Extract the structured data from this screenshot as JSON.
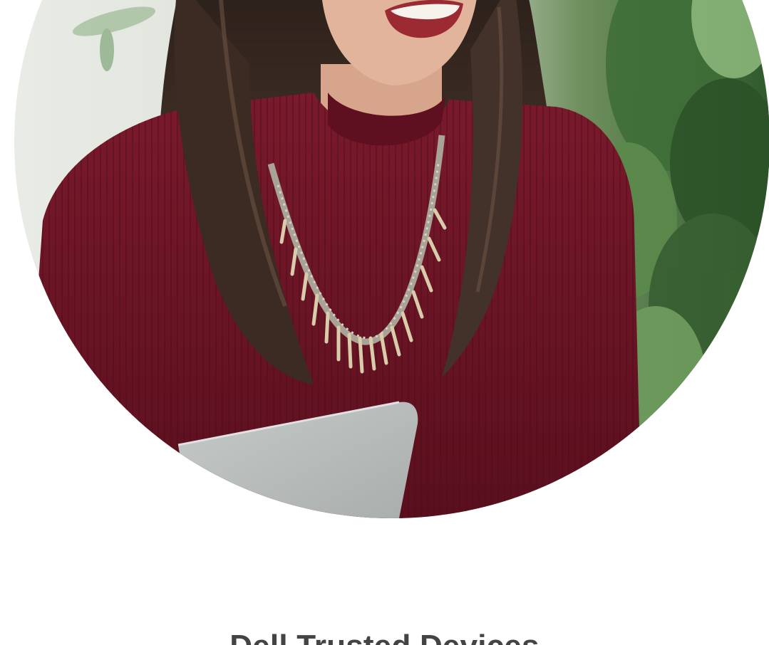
{
  "hero": {
    "image_subject": "woman-in-red-sweater-with-laptop",
    "colors": {
      "sweater": "#6e1526",
      "hair": "#3a2a22",
      "skin": "#e2b49c",
      "foliage": "#3d6b35",
      "background": "#dfe6dc",
      "laptop": "#b9bdbd"
    }
  },
  "content": {
    "title": "Dell Trusted Devices"
  }
}
